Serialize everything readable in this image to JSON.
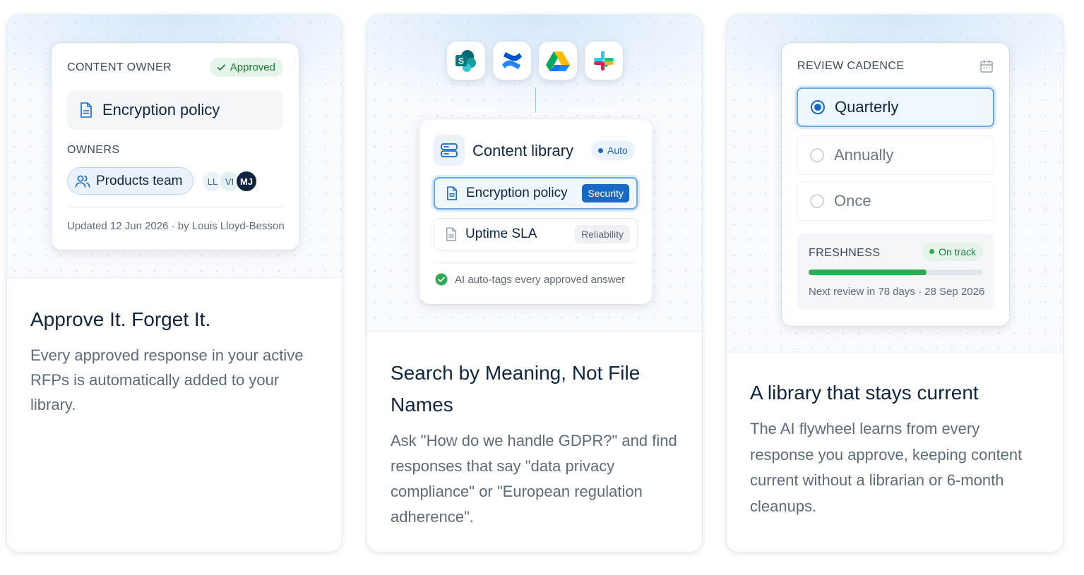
{
  "cards": [
    {
      "panel": {
        "label": "CONTENT OWNER",
        "status_badge": "Approved",
        "document_title": "Encryption policy",
        "owners_label": "OWNERS",
        "team_name": "Products team",
        "avatars": [
          "LL",
          "VI",
          "MJ"
        ],
        "updated_text": "Updated 12 Jun 2026 · by Louis Lloyd-Besson"
      },
      "heading": "Approve It. Forget It.",
      "description": "Every approved response in your active RFPs is automatically added to your library."
    },
    {
      "integrations": [
        "sharepoint-icon",
        "confluence-icon",
        "google-drive-icon",
        "slack-icon"
      ],
      "panel": {
        "title": "Content library",
        "mode_badge": "Auto",
        "items": [
          {
            "title": "Encryption policy",
            "tag": "Security"
          },
          {
            "title": "Uptime SLA",
            "tag": "Reliability"
          }
        ],
        "footer_text": "AI auto-tags every approved answer"
      },
      "heading": "Search by Meaning, Not File Names",
      "description": "Ask \"How do we handle GDPR?\" and find responses that say \"data privacy compliance\" or \"European regulation adherence\"."
    },
    {
      "panel": {
        "label": "REVIEW CADENCE",
        "options": [
          "Quarterly",
          "Annually",
          "Once"
        ],
        "selected_option": "Quarterly",
        "freshness_label": "FRESHNESS",
        "freshness_status": "On track",
        "freshness_progress": 0.68,
        "next_review_text": "Next review in 78 days · 28 Sep 2026"
      },
      "heading": "A library that stays current",
      "description": "The AI flywheel learns from every response you approve, keeping content current without a librarian or 6-month cleanups."
    }
  ],
  "colors": {
    "primary": "#1769c4",
    "success": "#2eaa52",
    "heading_text": "#0f2540",
    "muted_text": "#5d6b7b"
  }
}
